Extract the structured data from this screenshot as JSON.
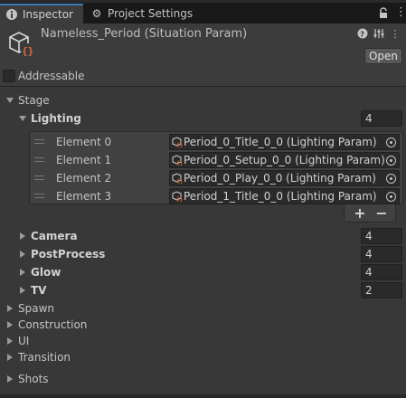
{
  "tabs": [
    {
      "label": "Inspector",
      "icon": "info-icon"
    },
    {
      "label": "Project Settings",
      "icon": "gear-icon"
    }
  ],
  "header": {
    "title": "Nameless_Period (Situation Param)",
    "open_label": "Open",
    "icons": [
      "help-icon",
      "settings-sliders-icon",
      "kebab-menu-icon"
    ]
  },
  "addressable": {
    "label": "Addressable",
    "checked": false
  },
  "stage": {
    "label": "Stage",
    "lighting": {
      "label": "Lighting",
      "size": "4",
      "elements": [
        {
          "label": "Element 0",
          "value": "Period_0_Title_0_0 (Lighting Param)"
        },
        {
          "label": "Element 1",
          "value": "Period_0_Setup_0_0 (Lighting Param)"
        },
        {
          "label": "Element 2",
          "value": "Period_0_Play_0_0 (Lighting Param)"
        },
        {
          "label": "Element 3",
          "value": "Period_1_Title_0_0 (Lighting Param)"
        }
      ],
      "add_label": "+",
      "remove_label": "−"
    },
    "camera": {
      "label": "Camera",
      "size": "4"
    },
    "postprocess": {
      "label": "PostProcess",
      "size": "4"
    },
    "glow": {
      "label": "Glow",
      "size": "4"
    },
    "tv": {
      "label": "TV",
      "size": "2"
    }
  },
  "sections": [
    {
      "label": "Spawn"
    },
    {
      "label": "Construction"
    },
    {
      "label": "UI"
    },
    {
      "label": "Transition"
    },
    {
      "label": "Shots"
    }
  ],
  "colors": {
    "accent": "#3a79bb",
    "background": "#383838",
    "field": "#2a2a2a"
  }
}
